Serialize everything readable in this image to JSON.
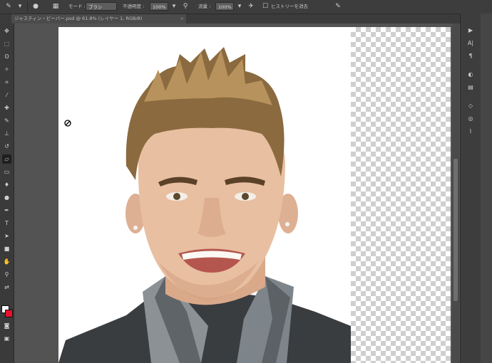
{
  "options_bar": {
    "mode_label": "モード :",
    "mode_value": "ブラシ",
    "opacity_label": "不透明度 :",
    "opacity_value": "100%",
    "flow_label": "流量 :",
    "flow_value": "100%",
    "history_label": "ヒストリーを消去"
  },
  "document_tab": {
    "title": "ジャスティン・ビーバー.psd @ 61.8% (レイヤー 1, RGB/8)",
    "close": "×"
  },
  "colors": {
    "ui_dark": "#3d3d3d",
    "canvas_bg": "#535353",
    "foreground": "#ffffff",
    "background": "#e8102c"
  },
  "tools": [
    "move-icon",
    "marquee-icon",
    "lasso-icon",
    "quick-select-icon",
    "crop-icon",
    "eyedropper-icon",
    "healing-icon",
    "brush-icon",
    "clone-stamp-icon",
    "history-brush-icon",
    "eraser-icon",
    "gradient-icon",
    "blur-icon",
    "dodge-icon",
    "pen-icon",
    "type-icon",
    "path-select-icon",
    "shape-icon",
    "hand-icon",
    "zoom-icon"
  ],
  "panels": [
    "play-icon",
    "character-icon",
    "paragraph-icon",
    "adjustments-icon",
    "styles-icon",
    "layers-icon",
    "channels-icon",
    "paths-icon"
  ]
}
